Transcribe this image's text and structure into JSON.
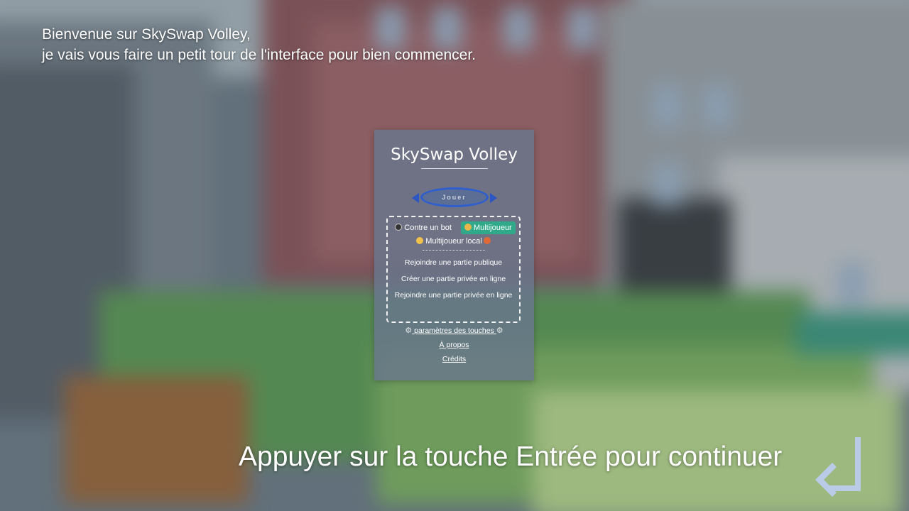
{
  "intro": {
    "line1": "Bienvenue sur SkySwap Volley,",
    "line2": "je vais vous faire un petit tour de l'interface pour bien commencer."
  },
  "menu": {
    "title": "SkySwap Volley",
    "play_label": "Jouer",
    "modes": {
      "bot_label": "Contre un bot",
      "multiplayer_label": "Multijoueur",
      "local_label": "Multijoueur local",
      "selected": "Multijoueur"
    },
    "online": [
      "Rejoindre une partie publique",
      "Créer une partie privée en ligne",
      "Rejoindre une partie privée en ligne"
    ],
    "links": {
      "keys": "paramètres des touches",
      "about": "À propos",
      "credits": "Crédits"
    }
  },
  "tutorial": {
    "continue_text": "Appuyer sur la touche Entrée pour continuer",
    "enter_icon": "enter-key-icon"
  },
  "colors": {
    "accent_green": "#2fa98a",
    "play_blue": "#2f5fcf",
    "panel": "#69768c"
  }
}
